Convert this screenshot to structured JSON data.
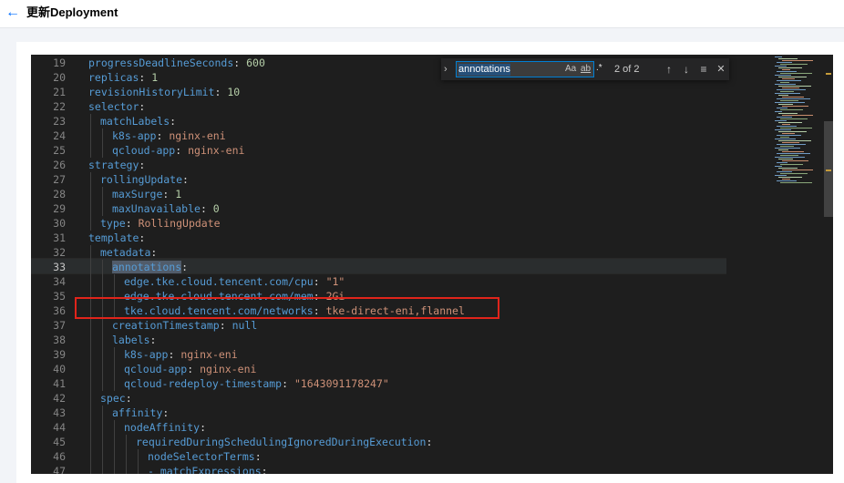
{
  "header": {
    "back_icon": "arrow-left-icon",
    "title": "更新Deployment"
  },
  "find": {
    "query": "annotations",
    "match_case": "Aa",
    "whole_word": "ab",
    "regex": ".*",
    "count": "2 of 2",
    "prev": "↑",
    "next": "↓",
    "in_selection": "≡",
    "close": "✕"
  },
  "lines": [
    {
      "n": "19",
      "indent": 1,
      "key": "progressDeadlineSeconds",
      "sep": ": ",
      "val": "600",
      "vt": "n"
    },
    {
      "n": "20",
      "indent": 1,
      "key": "replicas",
      "sep": ": ",
      "val": "1",
      "vt": "n"
    },
    {
      "n": "21",
      "indent": 1,
      "key": "revisionHistoryLimit",
      "sep": ": ",
      "val": "10",
      "vt": "n"
    },
    {
      "n": "22",
      "indent": 1,
      "key": "selector",
      "sep": ":",
      "val": "",
      "vt": "v"
    },
    {
      "n": "23",
      "indent": 2,
      "key": "matchLabels",
      "sep": ":",
      "val": "",
      "vt": "v"
    },
    {
      "n": "24",
      "indent": 3,
      "key": "k8s-app",
      "sep": ": ",
      "val": "nginx-eni",
      "vt": "v"
    },
    {
      "n": "25",
      "indent": 3,
      "key": "qcloud-app",
      "sep": ": ",
      "val": "nginx-eni",
      "vt": "v"
    },
    {
      "n": "26",
      "indent": 1,
      "key": "strategy",
      "sep": ":",
      "val": "",
      "vt": "v"
    },
    {
      "n": "27",
      "indent": 2,
      "key": "rollingUpdate",
      "sep": ":",
      "val": "",
      "vt": "v"
    },
    {
      "n": "28",
      "indent": 3,
      "key": "maxSurge",
      "sep": ": ",
      "val": "1",
      "vt": "n"
    },
    {
      "n": "29",
      "indent": 3,
      "key": "maxUnavailable",
      "sep": ": ",
      "val": "0",
      "vt": "n"
    },
    {
      "n": "30",
      "indent": 2,
      "key": "type",
      "sep": ": ",
      "val": "RollingUpdate",
      "vt": "v"
    },
    {
      "n": "31",
      "indent": 1,
      "key": "template",
      "sep": ":",
      "val": "",
      "vt": "v"
    },
    {
      "n": "32",
      "indent": 2,
      "key": "metadata",
      "sep": ":",
      "val": "",
      "vt": "v"
    },
    {
      "n": "33",
      "indent": 3,
      "key": "annotations",
      "sep": ":",
      "val": "",
      "vt": "v",
      "highlight": true,
      "active": true
    },
    {
      "n": "34",
      "indent": 4,
      "key": "edge.tke.cloud.tencent.com/cpu",
      "sep": ": ",
      "val": "\"1\"",
      "vt": "v"
    },
    {
      "n": "35",
      "indent": 4,
      "key": "edge.tke.cloud.tencent.com/mem",
      "sep": ": ",
      "val": "2Gi",
      "vt": "v"
    },
    {
      "n": "36",
      "indent": 4,
      "key": "tke.cloud.tencent.com/networks",
      "sep": ": ",
      "val": "tke-direct-eni,flannel",
      "vt": "v"
    },
    {
      "n": "37",
      "indent": 3,
      "key": "creationTimestamp",
      "sep": ": ",
      "val": "null",
      "vt": "c"
    },
    {
      "n": "38",
      "indent": 3,
      "key": "labels",
      "sep": ":",
      "val": "",
      "vt": "v"
    },
    {
      "n": "39",
      "indent": 4,
      "key": "k8s-app",
      "sep": ": ",
      "val": "nginx-eni",
      "vt": "v"
    },
    {
      "n": "40",
      "indent": 4,
      "key": "qcloud-app",
      "sep": ": ",
      "val": "nginx-eni",
      "vt": "v"
    },
    {
      "n": "41",
      "indent": 4,
      "key": "qcloud-redeploy-timestamp",
      "sep": ": ",
      "val": "\"1643091178247\"",
      "vt": "v"
    },
    {
      "n": "42",
      "indent": 2,
      "key": "spec",
      "sep": ":",
      "val": "",
      "vt": "v"
    },
    {
      "n": "43",
      "indent": 3,
      "key": "affinity",
      "sep": ":",
      "val": "",
      "vt": "v"
    },
    {
      "n": "44",
      "indent": 4,
      "key": "nodeAffinity",
      "sep": ":",
      "val": "",
      "vt": "v"
    },
    {
      "n": "45",
      "indent": 5,
      "key": "requiredDuringSchedulingIgnoredDuringExecution",
      "sep": ":",
      "val": "",
      "vt": "v"
    },
    {
      "n": "46",
      "indent": 6,
      "key": "nodeSelectorTerms",
      "sep": ":",
      "val": "",
      "vt": "v"
    },
    {
      "n": "47",
      "indent": 6,
      "key": "- matchExpressions",
      "sep": ":",
      "val": "",
      "vt": "v"
    }
  ],
  "colors": {
    "key": "#569cd6",
    "string": "#ce9178",
    "number": "#b5cea8",
    "highlight_box": "#e0241b",
    "link_blue": "#006eff"
  }
}
